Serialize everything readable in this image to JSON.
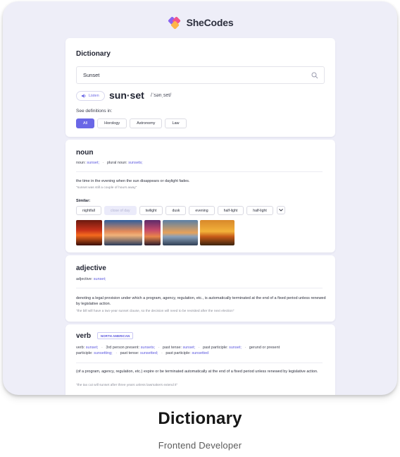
{
  "brand": {
    "name": "SheCodes",
    "logo_icon": "shecodes-logo-icon",
    "colors": {
      "pink": "#f2558c",
      "purple": "#8a63f0",
      "orange": "#ffb648",
      "accent": "#6a67e6"
    }
  },
  "search_card": {
    "title": "Dictionary",
    "search_value": "Sunset",
    "search_icon": "search-icon",
    "listen_label": "Listen",
    "listen_icon": "speaker-icon",
    "word": "sun·set",
    "phonetic": "/ˈsənˌset/",
    "see_definitions_label": "See definitions in:",
    "categories": [
      {
        "label": "All",
        "active": true
      },
      {
        "label": "Horology",
        "active": false
      },
      {
        "label": "Astronomy",
        "active": false
      },
      {
        "label": "Law",
        "active": false
      }
    ]
  },
  "noun": {
    "heading": "noun",
    "forms": {
      "noun_label": "noun:",
      "noun_value": "sunset;",
      "plural_label": "plural noun:",
      "plural_value": "sunsets;"
    },
    "definition": "the time in the evening when the sun disappears or daylight fades.",
    "example": "\"sunset was still a couple of hours away\"",
    "similar_label": "Similar:",
    "similar": [
      {
        "label": "nightfall",
        "muted": false
      },
      {
        "label": "close of day",
        "muted": true
      },
      {
        "label": "twilight",
        "muted": false
      },
      {
        "label": "dusk",
        "muted": false
      },
      {
        "label": "evening",
        "muted": false
      },
      {
        "label": "half-light",
        "muted": false
      },
      {
        "label": "half-light",
        "muted": false
      }
    ],
    "more_icon": "chevron-down-icon"
  },
  "adjective": {
    "heading": "adjective",
    "forms": {
      "label": "adjective:",
      "value": "sunset;"
    },
    "definition": "denoting a legal provision under which a program, agency, regulation, etc., is automatically terminated at the end of a fixed period unless renewed by legislative action.",
    "example": "\"the bill will have a two-year sunset clause, so the decision will need to be revisited after the next election\""
  },
  "verb": {
    "heading": "verb",
    "tag": "NORTH AMERICAN",
    "forms_line1": [
      {
        "label": "verb:",
        "value": "sunset;"
      },
      {
        "label": "3rd person present:",
        "value": "sunsets;"
      },
      {
        "label": "past tense:",
        "value": "sunset;"
      },
      {
        "label": "past participle:",
        "value": "sunset;"
      },
      {
        "label": "gerund or present",
        "value": ""
      }
    ],
    "forms_line2": [
      {
        "label": "participle:",
        "value": "sunsetting;"
      },
      {
        "label": "past tense:",
        "value": "sunsetted;"
      },
      {
        "label": "past participle:",
        "value": "sunsetted"
      }
    ],
    "definition": "(of a program, agency, regulation, etc.) expire or be terminated automatically at the end of a fixed period unless renewed by legislative action.",
    "example": "\"the tax cut will sunset after three years unless lawmakers extend it\""
  },
  "footer": {
    "title": "Dictionary",
    "subtitle": "Frontend Developer"
  }
}
